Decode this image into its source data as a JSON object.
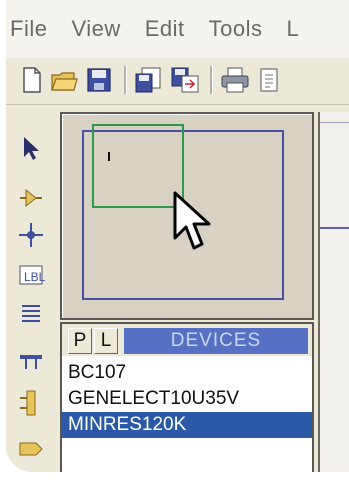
{
  "menubar": {
    "items": [
      {
        "label": "File"
      },
      {
        "label": "View"
      },
      {
        "label": "Edit"
      },
      {
        "label": "Tools"
      },
      {
        "label": "L"
      }
    ]
  },
  "toolbar": {
    "buttons": [
      "new-file-icon",
      "open-folder-icon",
      "save-icon",
      "import-section-icon",
      "export-section-icon",
      "print-icon",
      "mark-output-area-icon"
    ]
  },
  "left_toolbar": {
    "tools": [
      "select-arrow-icon",
      "component-icon",
      "junction-dot-icon",
      "wire-label-icon",
      "text-script-icon",
      "bus-icon",
      "subcircuit-icon",
      "terminal-icon"
    ]
  },
  "overview": {
    "content_marks": 1
  },
  "devices": {
    "p_button": "P",
    "l_button": "L",
    "title": "DEVICES",
    "items": [
      {
        "label": "BC107"
      },
      {
        "label": "GENELECT10U35V"
      },
      {
        "label": "MINRES120K"
      }
    ],
    "selected_index": 2
  },
  "colors": {
    "window_bg": "#ece9d8",
    "overview_frame": "#4b4fa6",
    "overview_view": "#2f9a4f",
    "devices_header": "#5670c4",
    "selection": "#2b59a8"
  }
}
